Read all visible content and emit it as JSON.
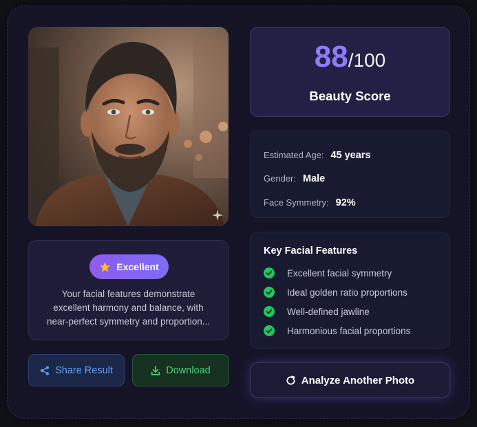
{
  "photo": {
    "icon": "face-portrait-photo"
  },
  "rating": {
    "badge_label": "Excellent",
    "badge_icon": "star-icon",
    "description": "Your facial features demonstrate\nexcellent harmony and balance, with\nnear-perfect symmetry and proportion..."
  },
  "actions": {
    "share_label": "Share Result",
    "share_icon": "share-icon",
    "download_label": "Download",
    "download_icon": "download-icon"
  },
  "score": {
    "value": "88",
    "max": "/100",
    "label": "Beauty Score"
  },
  "info": {
    "age_label": "Estimated Age:",
    "age_value": "45 years",
    "gender_label": "Gender:",
    "gender_value": "Male",
    "symmetry_label": "Face Symmetry:",
    "symmetry_value": "92%"
  },
  "features": {
    "title": "Key Facial Features",
    "items": [
      "Excellent facial symmetry",
      "Ideal golden ratio proportions",
      "Well-defined jawline",
      "Harmonious facial proportions"
    ]
  },
  "analyze": {
    "label": "Analyze Another Photo",
    "icon": "refresh-icon"
  },
  "colors": {
    "accent": "#8a7df5",
    "badge": "#8e5cf0",
    "share": "#5fa1f5",
    "download": "#46d57c",
    "check": "#22c55e"
  }
}
